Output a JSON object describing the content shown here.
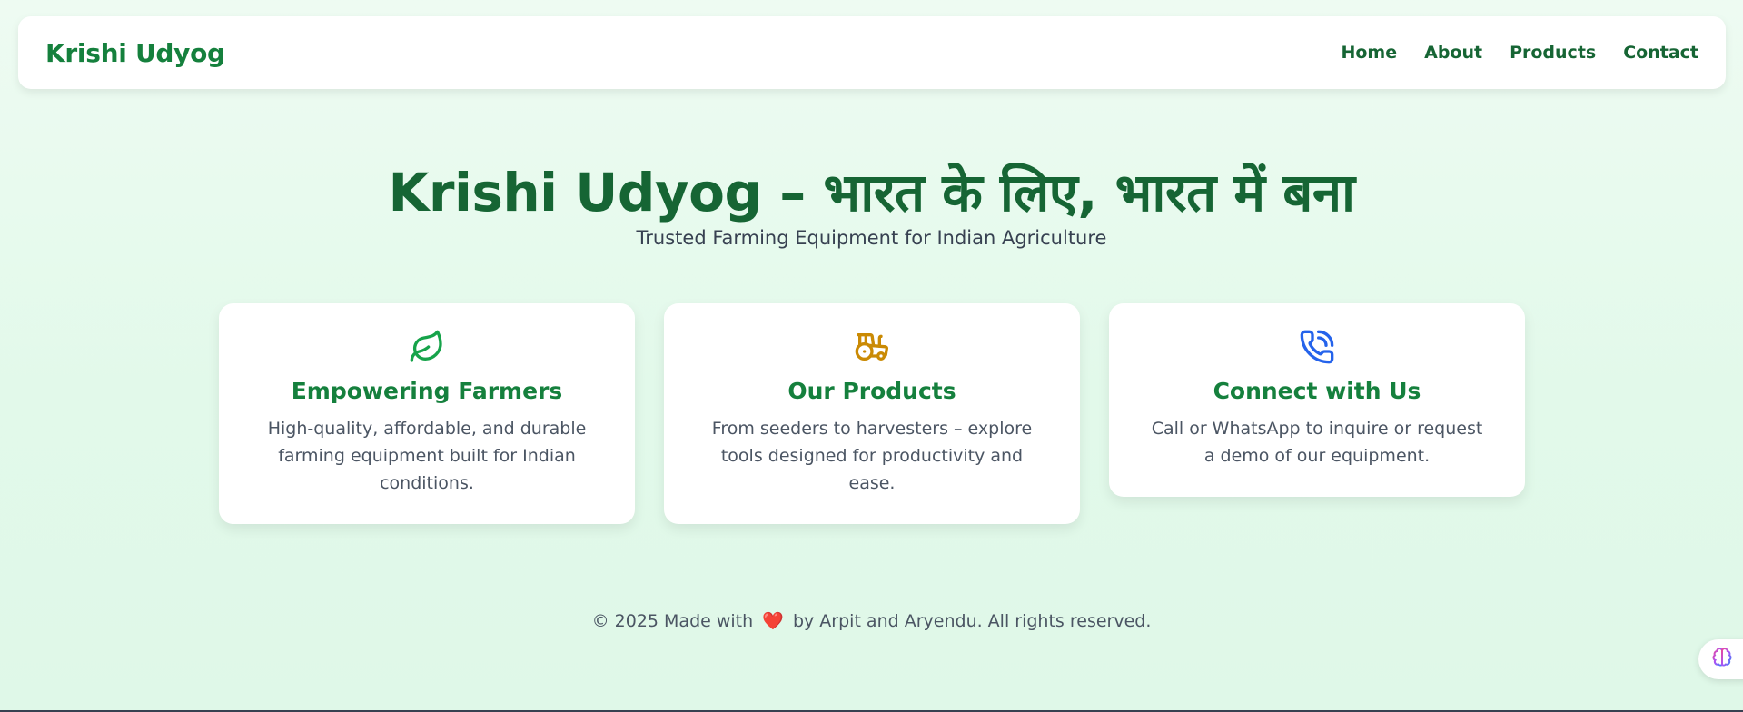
{
  "nav": {
    "brand": "Krishi Udyog",
    "links": [
      "Home",
      "About",
      "Products",
      "Contact"
    ]
  },
  "hero": {
    "title": "Krishi Udyog – भारत के लिए, भारत में बना",
    "subtitle": "Trusted Farming Equipment for Indian Agriculture"
  },
  "cards": [
    {
      "icon": "leaf-icon",
      "title": "Empowering Farmers",
      "text": "High-quality, affordable, and durable farming equipment built for Indian conditions."
    },
    {
      "icon": "tractor-icon",
      "title": "Our Products",
      "text": "From seeders to harvesters – explore tools designed for productivity and ease."
    },
    {
      "icon": "phone-icon",
      "title": "Connect with Us",
      "text": "Call or WhatsApp to inquire or request a demo of our equipment."
    }
  ],
  "footer": {
    "prefix": "© 2025 Made with",
    "heart": "❤️",
    "suffix": "by Arpit and Aryendu. All rights reserved."
  },
  "colors": {
    "brand_green": "#15803d",
    "dark_green": "#166534",
    "leaf_green": "#16a34a",
    "tractor_amber": "#ca8a04",
    "phone_blue": "#2563eb",
    "heart_red": "#ef4444"
  },
  "floating_button": {
    "icon": "brain-icon"
  }
}
